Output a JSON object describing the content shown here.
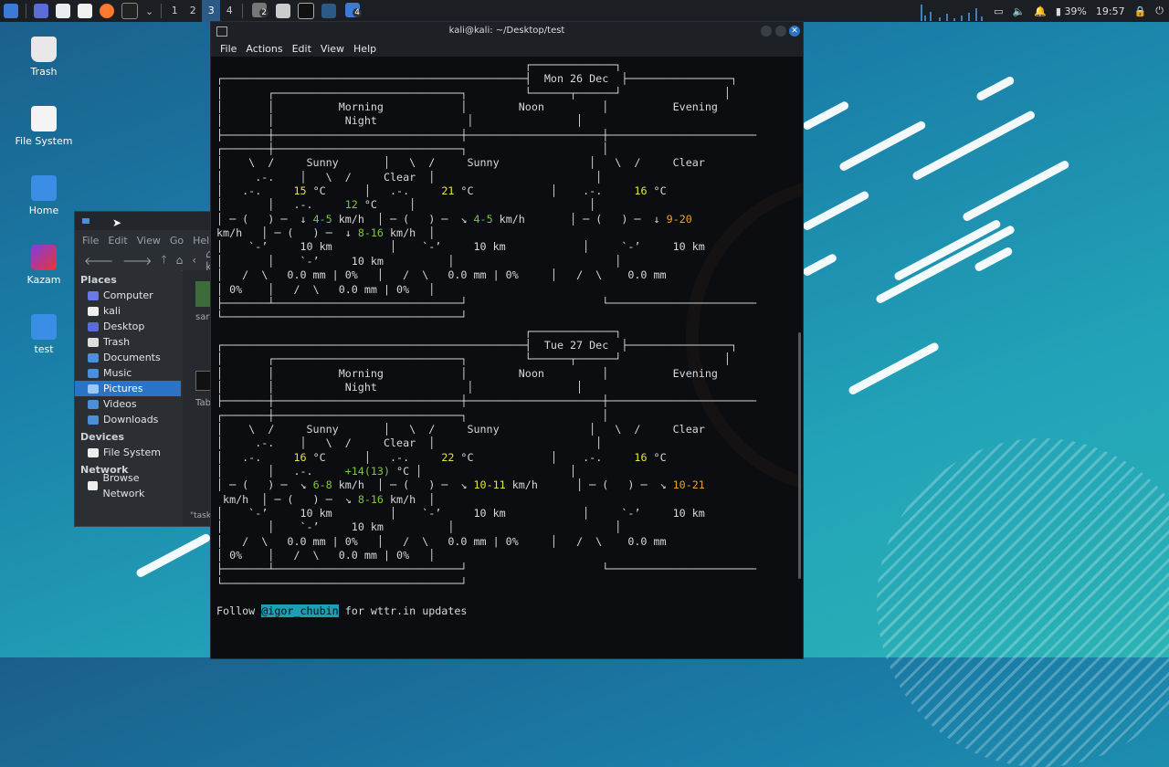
{
  "taskbar": {
    "workspaces": [
      "1",
      "2",
      "3",
      "4"
    ],
    "active_workspace": "3",
    "badge_left": "2",
    "badge_right": "4",
    "battery": "39%",
    "clock": "19:57"
  },
  "desktop_icons": [
    {
      "label": "Trash",
      "icon": "trash-icon"
    },
    {
      "label": "File System",
      "icon": "drive-icon"
    },
    {
      "label": "Home",
      "icon": "home-folder-icon"
    },
    {
      "label": "Kazam",
      "icon": "kazam-icon"
    },
    {
      "label": "test",
      "icon": "folder-icon"
    }
  ],
  "file_manager": {
    "menu": [
      "File",
      "Edit",
      "View",
      "Go",
      "Help"
    ],
    "location": "kali",
    "places_header": "Places",
    "places": [
      "Computer",
      "kali",
      "Desktop",
      "Trash",
      "Documents",
      "Music",
      "Pictures",
      "Videos",
      "Downloads"
    ],
    "selected_place": "Pictures",
    "devices_header": "Devices",
    "devices": [
      "File System"
    ],
    "network_header": "Network",
    "network": [
      "Browse Network"
    ],
    "content_items": [
      "sar",
      "Tab"
    ],
    "status": "\"task"
  },
  "terminal": {
    "title": "kali@kali: ~/Desktop/test",
    "menu": [
      "File",
      "Actions",
      "Edit",
      "View",
      "Help"
    ],
    "colors": {
      "yellow": "#e8e33a",
      "green": "#7ec83a",
      "orange": "#f0a22c",
      "highlight": "#1a9fb5"
    },
    "day1": {
      "date": "Mon 26 Dec",
      "periods": [
        "Morning",
        "Noon",
        "Evening",
        "Night"
      ],
      "morning": {
        "cond": "Sunny",
        "temp": "15",
        "wind": "4-5",
        "vis": "10 km",
        "rain": "0.0 mm | 0%"
      },
      "noon": {
        "cond": "Sunny",
        "temp": "21",
        "wind": "4-5",
        "vis": "10 km",
        "rain": "0.0 mm | 0%"
      },
      "evening": {
        "cond": "Clear",
        "temp": "16",
        "wind": "9-20",
        "vis": "10 km",
        "rain": "0.0 mm"
      },
      "night": {
        "cond": "Clear",
        "temp": "12",
        "wind": "8-16",
        "vis": "10 km",
        "rain": "0.0 mm | 0%"
      }
    },
    "day2": {
      "date": "Tue 27 Dec",
      "periods": [
        "Morning",
        "Noon",
        "Evening",
        "Night"
      ],
      "morning": {
        "cond": "Sunny",
        "temp": "16",
        "wind": "6-8",
        "vis": "10 km",
        "rain": "0.0 mm | 0%"
      },
      "noon": {
        "cond": "Sunny",
        "temp": "22",
        "wind": "10-11",
        "vis": "10 km",
        "rain": "0.0 mm | 0%"
      },
      "evening": {
        "cond": "Clear",
        "temp": "16",
        "wind": "10-21",
        "vis": "10 km",
        "rain": "0.0 mm"
      },
      "night": {
        "cond": "Clear",
        "temp": "+14(13)",
        "wind": "8-16",
        "vis": "10 km",
        "rain": "0.0 mm | 0%"
      }
    },
    "follow_prefix": "Follow ",
    "follow_handle": "@igor_chubin",
    "follow_suffix": " for wttr.in updates"
  }
}
